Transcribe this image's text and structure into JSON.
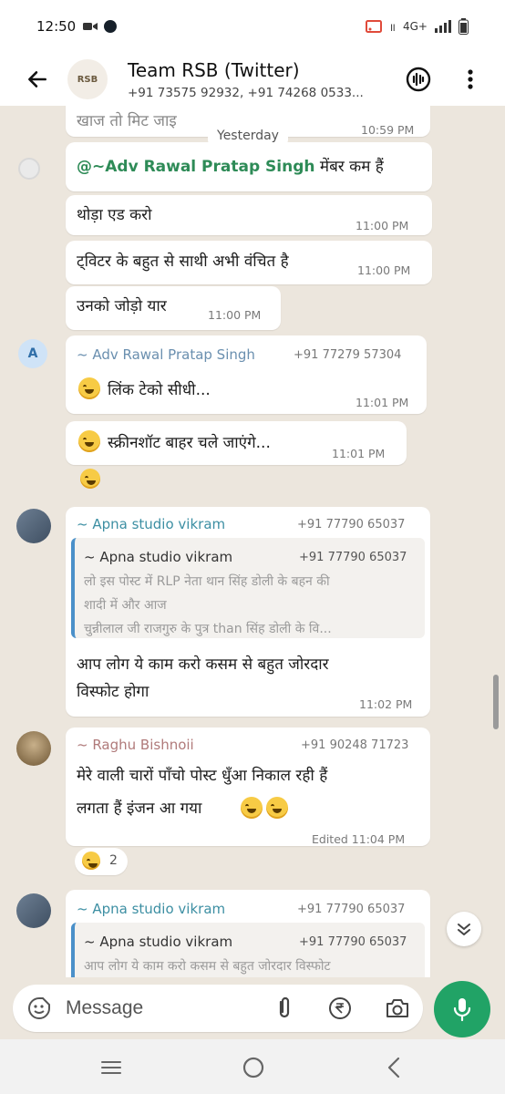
{
  "status_bar": {
    "time": "12:50",
    "network": "4G+"
  },
  "header": {
    "title": "Team RSB (Twitter)",
    "subtitle": "+91 73575 92932, +91 74268 0533...",
    "avatar_text": "RSB"
  },
  "chat": {
    "cut_text": "खाज तो मिट जाइ",
    "date_label": "Yesterday",
    "cut_time": "10:59 PM",
    "msg1": {
      "mention": "@~Adv Rawal Pratap Singh",
      "text": "मेंबर कम हैं"
    },
    "msg2": {
      "text": "थोड़ा एड करो",
      "time": "11:00 PM"
    },
    "msg3": {
      "text": "ट्विटर के बहुत से साथी अभी वंचित है",
      "time": "11:00 PM"
    },
    "msg4": {
      "text": "उनको जोड़ो यार",
      "time": "11:00 PM"
    },
    "msg5": {
      "avatar_letter": "A",
      "sender": "~ Adv Rawal Pratap Singh",
      "phone": "+91 77279 57304",
      "text": "लिंक टेको सीधी...",
      "time": "11:01 PM"
    },
    "msg6": {
      "text": "स्क्रीनशॉट बाहर चले जाएंगे...",
      "time": "11:01 PM"
    },
    "msg7": {
      "sender": "~ Apna studio vikram",
      "phone": "+91 77790 65037",
      "quote_sender": "~ Apna studio vikram",
      "quote_phone": "+91 77790 65037",
      "quote_line1": "लो इस पोस्ट में RLP नेता थान सिंह डोली के बहन की",
      "quote_line2": "शादी में और आज",
      "quote_line3": "चुन्नीलाल जी राजगुरु के पुत्र than सिंह डोली के वि...",
      "text_line1": "आप लोग ये काम करो कसम से बहुत जोरदार",
      "text_line2": "विस्फोट होगा",
      "time": "11:02 PM"
    },
    "msg8": {
      "sender": "~ Raghu Bishnoii",
      "phone": "+91 90248 71723",
      "text_line1": "मेरे वाली चारों पाँचो पोस्ट धुँआ निकाल रही हैं",
      "text_line2": "लगता हैं इंजन आ गया",
      "time": "Edited 11:04 PM",
      "reaction_count": "2"
    },
    "msg9": {
      "sender": "~ Apna studio vikram",
      "phone": "+91 77790 65037",
      "quote_sender": "~ Apna studio vikram",
      "quote_phone": "+91 77790 65037",
      "quote_line1": "आप लोग ये काम करो कसम से बहुत जोरदार विस्फोट"
    }
  },
  "input": {
    "placeholder": "Message"
  },
  "colors": {
    "accent": "#21a366",
    "chat_bg": "#ece6dd",
    "mention": "#2e8b57"
  }
}
